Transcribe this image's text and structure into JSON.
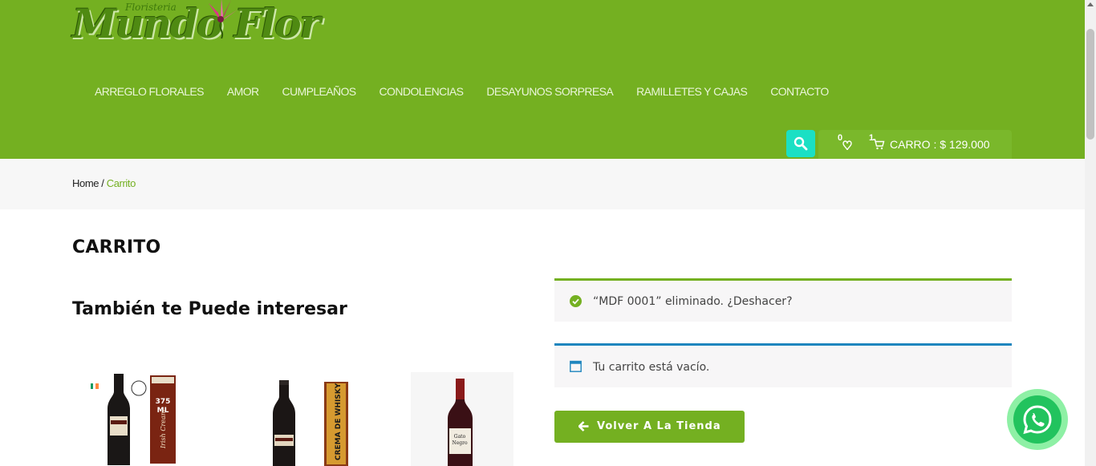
{
  "logo": {
    "script_text": "Mundo Flor",
    "small_text": "Floristeria"
  },
  "nav": {
    "items": [
      {
        "label": "ARREGLO FLORALES"
      },
      {
        "label": "AMOR"
      },
      {
        "label": "CUMPLEAÑOS"
      },
      {
        "label": "CONDOLENCIAS"
      },
      {
        "label": "DESAYUNOS SORPRESA"
      },
      {
        "label": "RAMILLETES Y CAJAS"
      },
      {
        "label": "CONTACTO"
      }
    ]
  },
  "header_tools": {
    "wishlist_count": "0",
    "cart_count": "1",
    "cart_label": "CARRO : $ 129.000",
    "icons": [
      "search-icon",
      "heart-icon",
      "cart-icon"
    ]
  },
  "breadcrumb": {
    "home": "Home",
    "separator": "/",
    "current": "Carrito"
  },
  "page": {
    "title": "CARRITO",
    "cross_sell_title": "También te Puede interesar"
  },
  "products": {
    "p1": {
      "badge": "375 ML",
      "brand": "BAILEYS",
      "sub": "Irish Cream"
    },
    "p2": {
      "brand": "BAILEYS",
      "side_label": "CREMA DE WHISKY"
    },
    "p3": {
      "brand": "Gato Negro"
    }
  },
  "notices": {
    "removed": "“MDF 0001” eliminado. ¿Deshacer?",
    "empty": "Tu carrito está vacío."
  },
  "back_button": {
    "label": "Volver A La Tienda"
  },
  "colors": {
    "brand_green": "#74b021",
    "search_teal": "#1be0c4",
    "info_blue": "#1e85be",
    "whatsapp": "#22c35e"
  }
}
